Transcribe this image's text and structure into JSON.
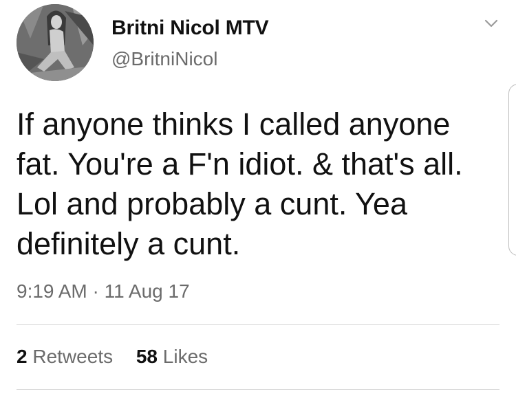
{
  "author": {
    "name": "Britni Nicol MTV",
    "handle": "@BritniNicol"
  },
  "tweet": {
    "text": "If anyone thinks I called anyone fat. You're a F'n idiot. & that's all. Lol and probably a cunt. Yea definitely a cunt.",
    "timestamp": "9:19 AM · 11 Aug 17"
  },
  "stats": {
    "retweets_count": "2",
    "retweets_label": "Retweets",
    "likes_count": "58",
    "likes_label": "Likes"
  },
  "icons": {
    "menu": "chevron-down-icon"
  }
}
